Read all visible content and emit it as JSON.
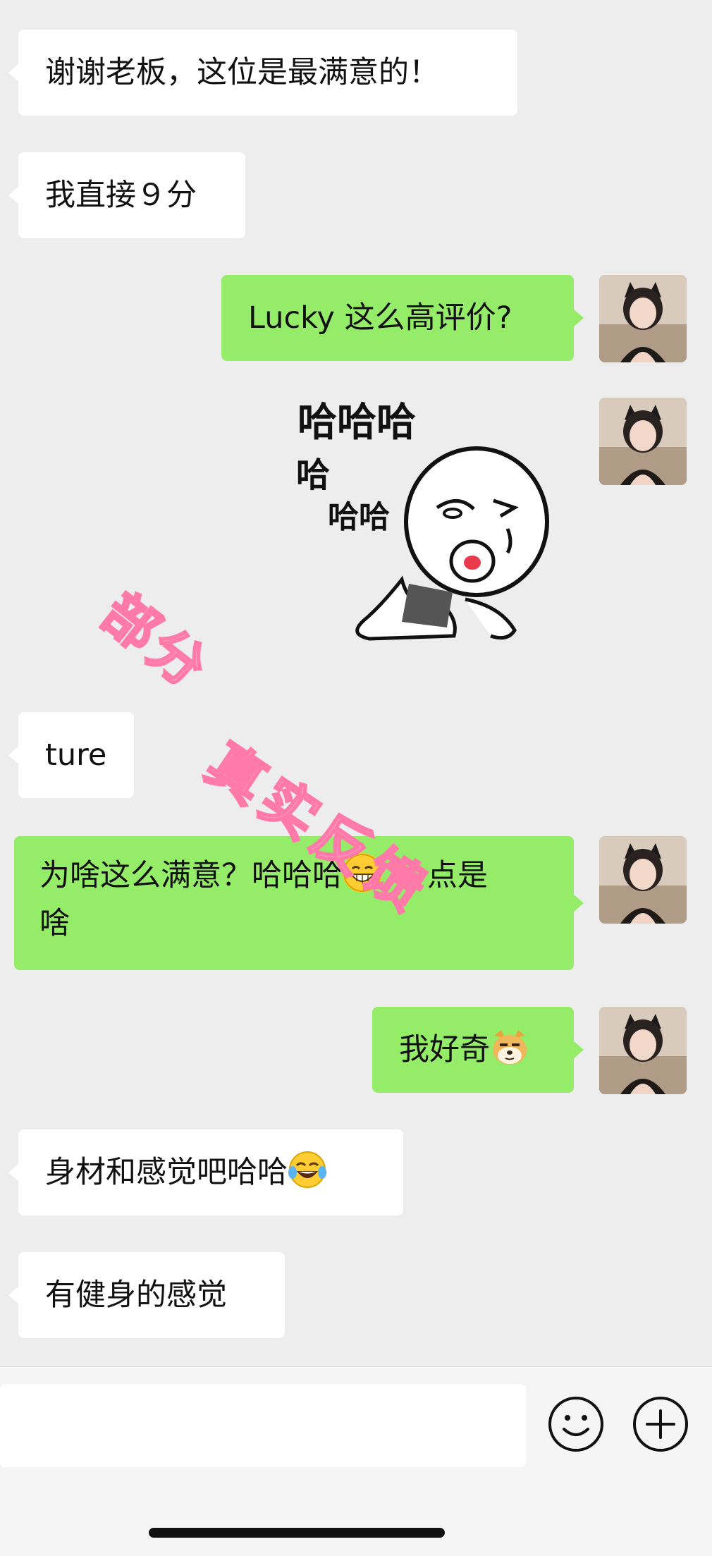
{
  "messages": [
    {
      "side": "left",
      "text": "谢谢老板，这位是最满意的！"
    },
    {
      "side": "left",
      "text": "我直接９分"
    },
    {
      "side": "right",
      "text": "Lucky 这么高评价?"
    },
    {
      "side": "right",
      "sticker": {
        "line1": "哈哈哈",
        "line2": "哈",
        "line3": "哈哈"
      }
    },
    {
      "side": "left",
      "text": "ture"
    },
    {
      "side": "right",
      "text_line1": "为啥这么满意？哈哈哈",
      "emoji": "grin-emoji",
      "text_line1_b": "点是",
      "text_line2": "啥"
    },
    {
      "side": "right",
      "text": "我好奇",
      "emoji": "doge-emoji"
    },
    {
      "side": "left",
      "text": "身材和感觉吧哈哈",
      "emoji": "tears-of-joy-emoji"
    },
    {
      "side": "left",
      "text": "有健身的感觉"
    }
  ],
  "watermark": {
    "part1": "部分",
    "part2": "真实反馈",
    "color": "#ff8fb8"
  },
  "input": {
    "value": "",
    "placeholder": ""
  },
  "icons": {
    "emoji_button": "smiley-icon",
    "plus_button": "plus-circle-icon"
  },
  "colors": {
    "background": "#ededed",
    "bubble_left": "#ffffff",
    "bubble_right": "#95ec69"
  }
}
